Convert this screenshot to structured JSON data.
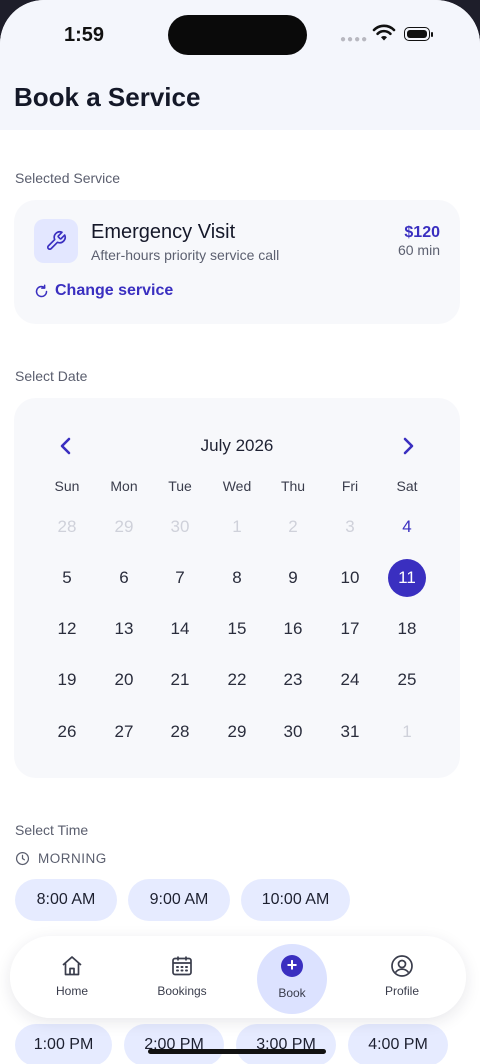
{
  "status_bar": {
    "time": "1:59"
  },
  "page": {
    "title": "Book a Service"
  },
  "selected_service": {
    "section_label": "Selected Service",
    "icon": "wrench-icon",
    "name": "Emergency Visit",
    "description": "After-hours priority service call",
    "price": "$120",
    "duration": "60 min",
    "change_label": "Change service"
  },
  "date": {
    "section_label": "Select Date",
    "month_label": "July 2026",
    "weekdays": [
      "Sun",
      "Mon",
      "Tue",
      "Wed",
      "Thu",
      "Fri",
      "Sat"
    ],
    "weeks": [
      [
        "28",
        "29",
        "30",
        "1",
        "2",
        "3",
        "4"
      ],
      [
        "5",
        "6",
        "7",
        "8",
        "9",
        "10",
        "11"
      ],
      [
        "12",
        "13",
        "14",
        "15",
        "16",
        "17",
        "18"
      ],
      [
        "19",
        "20",
        "21",
        "22",
        "23",
        "24",
        "25"
      ],
      [
        "26",
        "27",
        "28",
        "29",
        "30",
        "31",
        "1"
      ]
    ],
    "selected_day": "11"
  },
  "time": {
    "section_label": "Select Time",
    "morning_label": "MORNING",
    "morning_slots": [
      "8:00 AM",
      "9:00 AM",
      "10:00 AM"
    ],
    "afternoon_slots": [
      "1:00 PM",
      "2:00 PM",
      "3:00 PM",
      "4:00 PM"
    ]
  },
  "tabbar": {
    "items": [
      {
        "label": "Home",
        "icon": "home-icon"
      },
      {
        "label": "Bookings",
        "icon": "calendar-icon"
      },
      {
        "label": "Book",
        "icon": "plus-circle-icon"
      },
      {
        "label": "Profile",
        "icon": "user-circle-icon"
      }
    ],
    "active": "Book"
  },
  "colors": {
    "accent": "#3a2fc0",
    "chip": "#e6ebff",
    "card": "#f7f8fb"
  }
}
